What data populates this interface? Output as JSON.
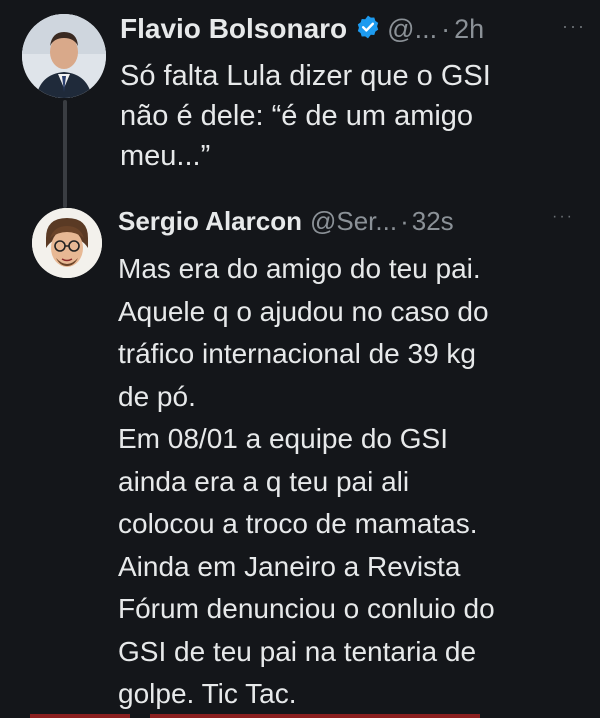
{
  "tweet1": {
    "name": "Flavio Bolsonaro",
    "handle": "@...",
    "separator": "·",
    "time": "2h",
    "lines": [
      "Só falta Lula dizer que o GSI",
      "não é dele: “é de um amigo",
      "meu...”"
    ]
  },
  "tweet2": {
    "name": "Sergio Alarcon",
    "handle": "@Ser...",
    "separator": "·",
    "time": "32s",
    "lines": [
      "Mas era do amigo do teu pai.",
      "Aquele q o ajudou no caso do",
      "tráfico internacional de 39 kg",
      "de pó.",
      "Em 08/01 a equipe do GSI",
      "ainda era a q teu pai ali",
      "colocou a troco de mamatas.",
      "Ainda em Janeiro a Revista",
      "Fórum denunciou o conluio do",
      "GSI de teu pai na tentaria de",
      "golpe. Tic Tac."
    ]
  },
  "icons": {
    "verified": "verified-badge-icon",
    "more": "more-options-icon"
  },
  "colors": {
    "background": "#14161a",
    "verified_blue": "#1d9bf0",
    "text": "#e7e9ea",
    "muted": "#8b9197"
  }
}
